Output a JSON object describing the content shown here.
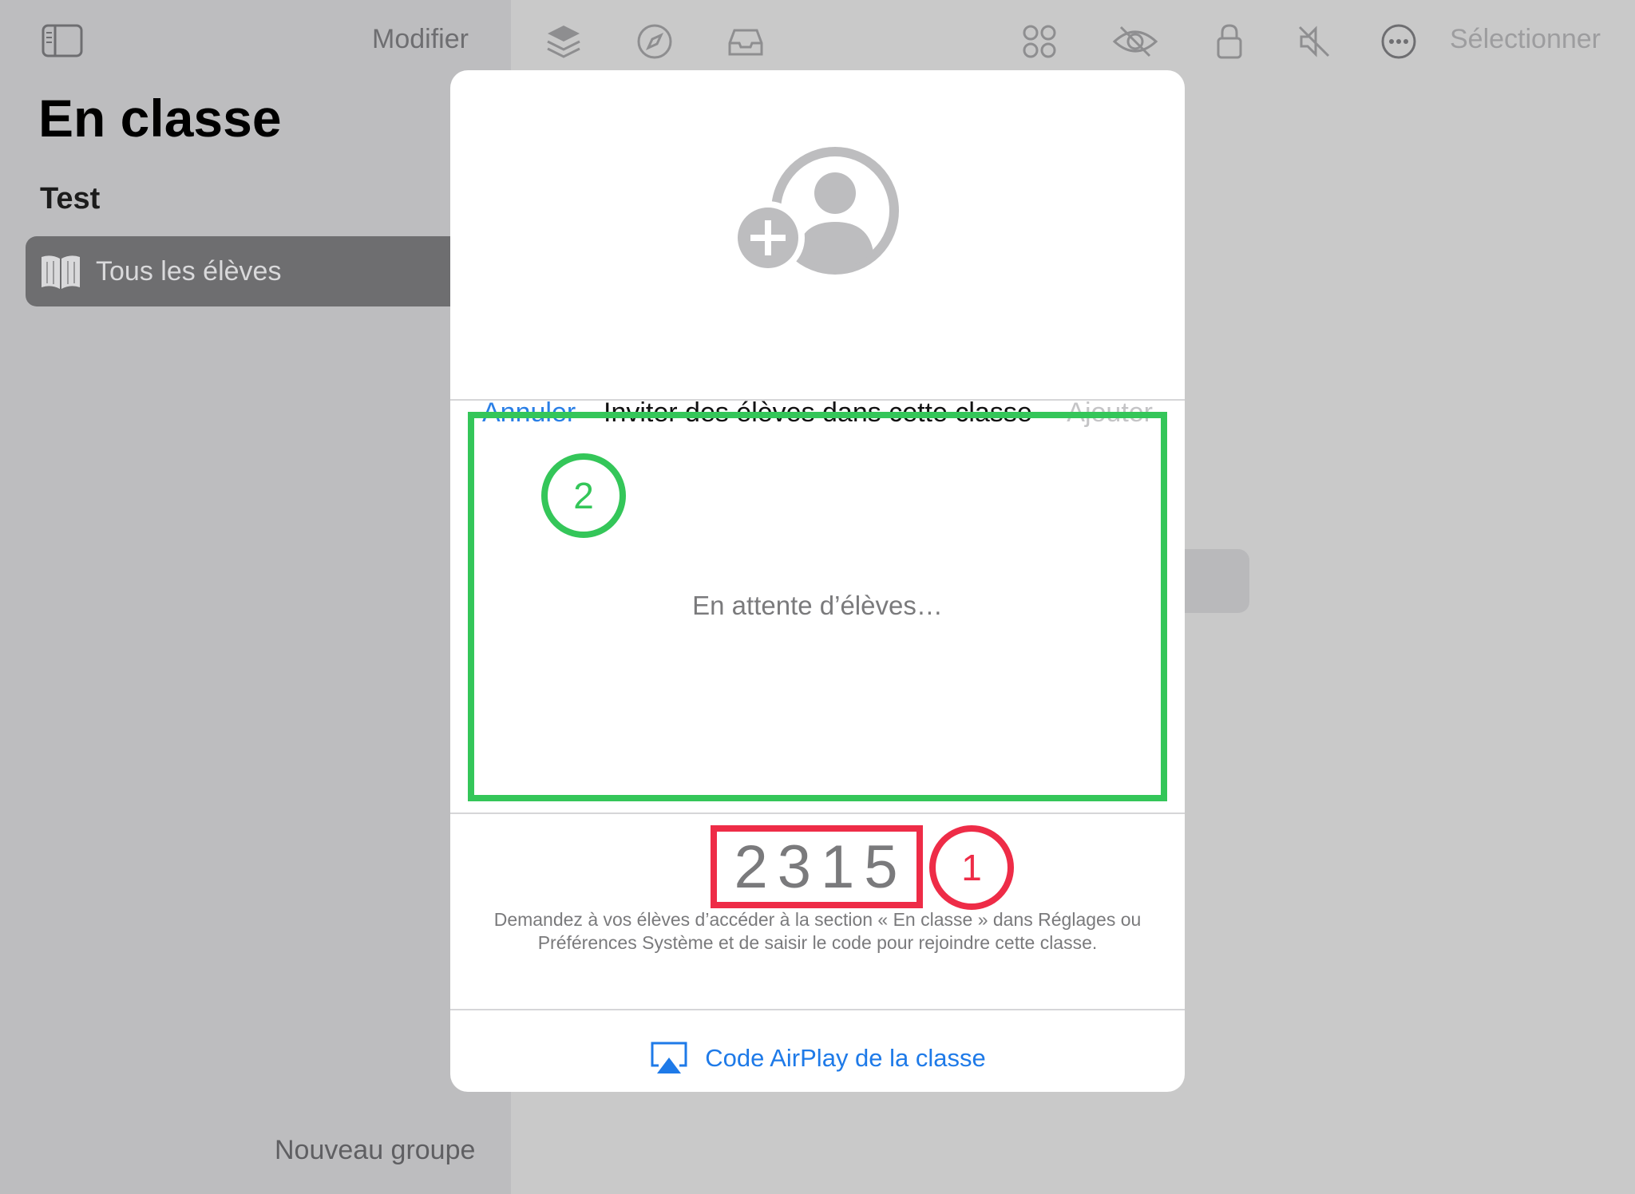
{
  "sidebar": {
    "edit_label": "Modifier",
    "app_title": "En classe",
    "section_title": "Test",
    "all_students_label": "Tous les élèves",
    "new_group_label": "Nouveau groupe"
  },
  "toolbar": {
    "select_label": "Sélectionner",
    "icons": [
      "layers-icon",
      "compass-icon",
      "tray-icon",
      "grid-icon",
      "hide-icon",
      "lock-icon",
      "mute-icon",
      "more-icon"
    ]
  },
  "modal": {
    "cancel_label": "Annuler",
    "title": "Inviter des élèves dans cette classe",
    "add_label": "Ajouter",
    "waiting_text": "En attente d’élèves…",
    "marker_2": "2",
    "class_code": "2315",
    "marker_1": "1",
    "help_text": "Demandez à vos élèves d’accéder à la section « En classe » dans Réglages ou Préférences Système et de saisir le code pour rejoindre cette classe.",
    "airplay_label": "Code AirPlay de la classe"
  },
  "colors": {
    "accent": "#2a7fe6",
    "highlight_green": "#34c659",
    "highlight_red": "#ee2c47"
  }
}
